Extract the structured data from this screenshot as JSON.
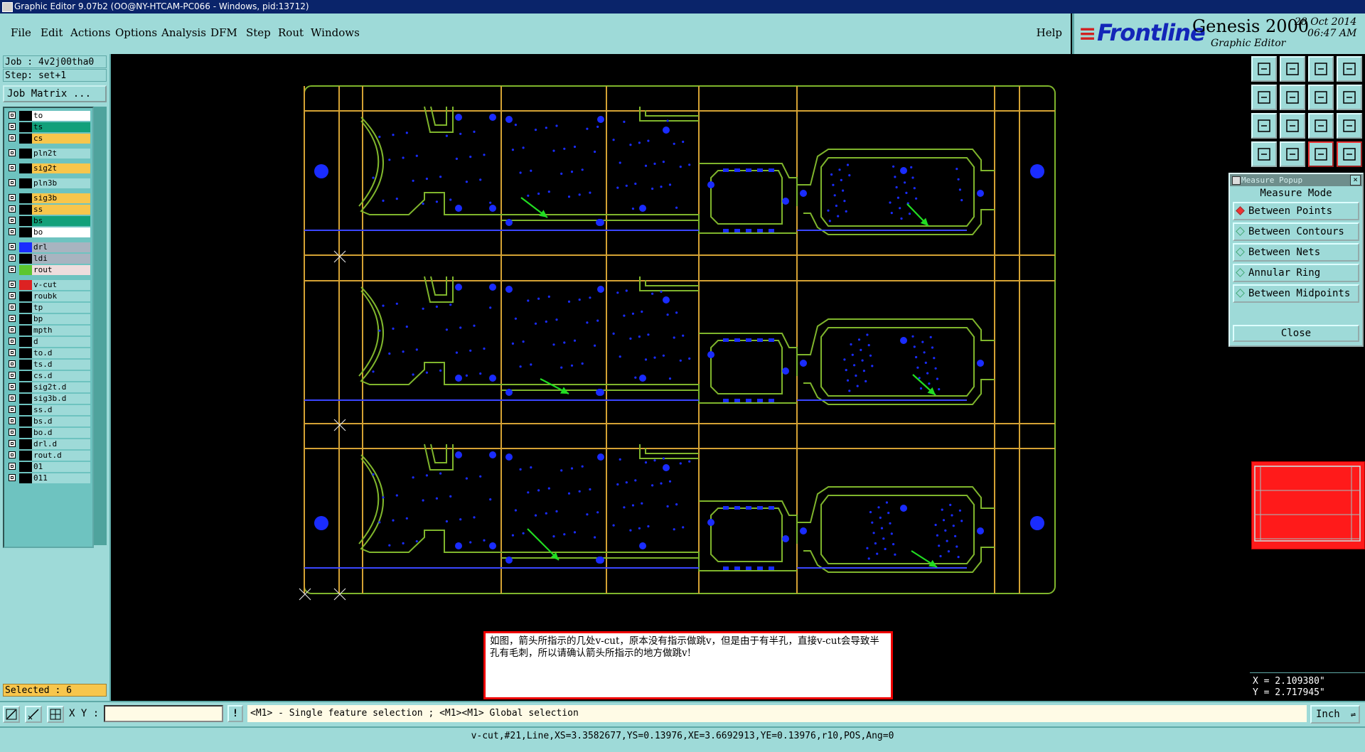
{
  "window": {
    "title": "Graphic Editor 9.07b2 (OO@NY-HTCAM-PC066 - Windows, pid:13712)"
  },
  "menu": [
    "File",
    "Edit",
    "Actions",
    "Options",
    "Analysis",
    "DFM",
    "Step",
    "Rout",
    "Windows"
  ],
  "help": "Help",
  "brand": {
    "logo": "Frontline",
    "product": "Genesis 2000",
    "subtitle": "Graphic Editor",
    "date": "28 Oct 2014",
    "time": "06:47 AM"
  },
  "job": {
    "job_line": "Job : 4v2j00tha0",
    "step_line": "Step: set+1",
    "matrix_button": "Job Matrix ..."
  },
  "layers": [
    {
      "name": "to",
      "color": "#ffffff"
    },
    {
      "name": "ts",
      "color": "#12a07a"
    },
    {
      "name": "cs",
      "color": "#f7c64c"
    },
    {
      "name": "pln2t",
      "color": "#9edad8"
    },
    {
      "name": "sig2t",
      "color": "#f7c64c"
    },
    {
      "name": "pln3b",
      "color": "#9edad8"
    },
    {
      "name": "sig3b",
      "color": "#f7c64c"
    },
    {
      "name": "ss",
      "color": "#f7c64c"
    },
    {
      "name": "bs",
      "color": "#12a07a"
    },
    {
      "name": "bo",
      "color": "#ffffff"
    },
    {
      "name": "drl",
      "color": "#a8b4c0"
    },
    {
      "name": "ldi",
      "color": "#a8b4c0"
    },
    {
      "name": "rout",
      "color": "#eedddd"
    },
    {
      "name": "v-cut",
      "color": "#9edad8"
    },
    {
      "name": "roubk",
      "color": "#9edad8"
    },
    {
      "name": "tp",
      "color": "#9edad8"
    },
    {
      "name": "bp",
      "color": "#9edad8"
    },
    {
      "name": "mpth",
      "color": "#9edad8"
    },
    {
      "name": "d",
      "color": "#9edad8"
    },
    {
      "name": "to.d",
      "color": "#9edad8"
    },
    {
      "name": "ts.d",
      "color": "#9edad8"
    },
    {
      "name": "cs.d",
      "color": "#9edad8"
    },
    {
      "name": "sig2t.d",
      "color": "#9edad8"
    },
    {
      "name": "sig3b.d",
      "color": "#9edad8"
    },
    {
      "name": "ss.d",
      "color": "#9edad8"
    },
    {
      "name": "bs.d",
      "color": "#9edad8"
    },
    {
      "name": "bo.d",
      "color": "#9edad8"
    },
    {
      "name": "drl.d",
      "color": "#9edad8"
    },
    {
      "name": "rout.d",
      "color": "#9edad8"
    },
    {
      "name": "01",
      "color": "#9edad8"
    },
    {
      "name": "011",
      "color": "#9edad8"
    }
  ],
  "selected": "Selected : 6",
  "measure_popup": {
    "title": "Measure Popup",
    "mode_label": "Measure Mode",
    "options": [
      "Between Points",
      "Between Contours",
      "Between Nets",
      "Annular Ring",
      "Between Midpoints"
    ],
    "close": "Close"
  },
  "coords": {
    "x": "X = 2.109380\"",
    "y": "Y = 2.717945\""
  },
  "note": "如图，箭头所指示的几处v-cut，原本没有指示做跳v，但是由于有半孔，直接v-cut会导致半孔有毛刺，所以请确认箭头所指示的地方做跳v!",
  "bottom": {
    "xy_label": "X Y :",
    "xy_value": "",
    "prompt": "<M1> - Single feature selection ; <M1><M1> Global selection",
    "units": "Inch"
  },
  "status": "v-cut,#21,Line,XS=3.3582677,YS=0.13976,XE=3.6692913,YE=0.13976,r10,POS,Ang=0",
  "colors": {
    "panel": "#9edad8",
    "outline": "#7fb52c",
    "vcut": "#d4a234",
    "feature": "#1a2cff",
    "arrow": "#22dd22",
    "active_vcut": "#3a46ff"
  }
}
